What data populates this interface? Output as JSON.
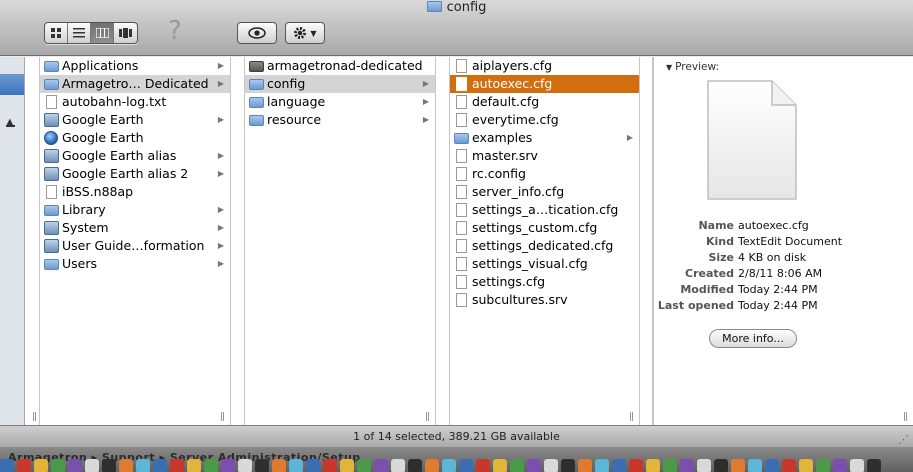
{
  "window": {
    "title": "config"
  },
  "toolbar": {
    "view_buttons": [
      "icon-view",
      "list-view",
      "column-view",
      "coverflow-view"
    ],
    "help_glyph": "?",
    "quicklook_icon": "eye-icon",
    "action_icon": "gear-icon"
  },
  "columns": [
    {
      "items": [
        {
          "label": "Applications",
          "icon": "folder",
          "arrow": true
        },
        {
          "label": "Armagetro… Dedicated",
          "icon": "folder",
          "arrow": true,
          "state": "selected-inactive"
        },
        {
          "label": "autobahn-log.txt",
          "icon": "doc",
          "arrow": false
        },
        {
          "label": "Google Earth",
          "icon": "alias",
          "arrow": true
        },
        {
          "label": "Google Earth",
          "icon": "globe",
          "arrow": false
        },
        {
          "label": "Google Earth alias",
          "icon": "alias",
          "arrow": true
        },
        {
          "label": "Google Earth alias 2",
          "icon": "alias",
          "arrow": true
        },
        {
          "label": "iBSS.n88ap",
          "icon": "doc",
          "arrow": false
        },
        {
          "label": "Library",
          "icon": "folder",
          "arrow": true
        },
        {
          "label": "System",
          "icon": "alias",
          "arrow": true
        },
        {
          "label": "User Guide…formation",
          "icon": "alias",
          "arrow": true
        },
        {
          "label": "Users",
          "icon": "folder",
          "arrow": true
        }
      ]
    },
    {
      "items": [
        {
          "label": "armagetronad-dedicated",
          "icon": "folder-dark",
          "arrow": false
        },
        {
          "label": "config",
          "icon": "folder",
          "arrow": true,
          "state": "selected-inactive"
        },
        {
          "label": "language",
          "icon": "folder",
          "arrow": true
        },
        {
          "label": "resource",
          "icon": "folder",
          "arrow": true
        }
      ]
    },
    {
      "items": [
        {
          "label": "aiplayers.cfg",
          "icon": "doc",
          "arrow": false
        },
        {
          "label": "autoexec.cfg",
          "icon": "doc",
          "arrow": false,
          "state": "selected"
        },
        {
          "label": "default.cfg",
          "icon": "doc",
          "arrow": false
        },
        {
          "label": "everytime.cfg",
          "icon": "doc",
          "arrow": false
        },
        {
          "label": "examples",
          "icon": "folder",
          "arrow": true
        },
        {
          "label": "master.srv",
          "icon": "doc",
          "arrow": false
        },
        {
          "label": "rc.config",
          "icon": "doc",
          "arrow": false
        },
        {
          "label": "server_info.cfg",
          "icon": "doc",
          "arrow": false
        },
        {
          "label": "settings_a…tication.cfg",
          "icon": "doc",
          "arrow": false
        },
        {
          "label": "settings_custom.cfg",
          "icon": "doc",
          "arrow": false
        },
        {
          "label": "settings_dedicated.cfg",
          "icon": "doc",
          "arrow": false
        },
        {
          "label": "settings_visual.cfg",
          "icon": "doc",
          "arrow": false
        },
        {
          "label": "settings.cfg",
          "icon": "doc",
          "arrow": false
        },
        {
          "label": "subcultures.srv",
          "icon": "doc",
          "arrow": false
        }
      ]
    }
  ],
  "preview": {
    "title": "Preview:",
    "info": [
      {
        "key": "Name",
        "value": "autoexec.cfg"
      },
      {
        "key": "Kind",
        "value": "TextEdit Document"
      },
      {
        "key": "Size",
        "value": "4 KB on disk"
      },
      {
        "key": "Created",
        "value": "2/8/11 8:06 AM"
      },
      {
        "key": "Modified",
        "value": "Today 2:44 PM"
      },
      {
        "key": "Last opened",
        "value": "Today 2:44 PM"
      }
    ],
    "more_info_label": "More info..."
  },
  "status": {
    "text": "1 of 14 selected, 389.21 GB available"
  },
  "bottom": {
    "path_text": "Armagetron  ▸  Support  ▸  Server Administration/Setup"
  },
  "colors": {
    "selection": "#d26d10",
    "inactive_selection": "#d4d4d4",
    "folder": "#6e9bd2"
  }
}
